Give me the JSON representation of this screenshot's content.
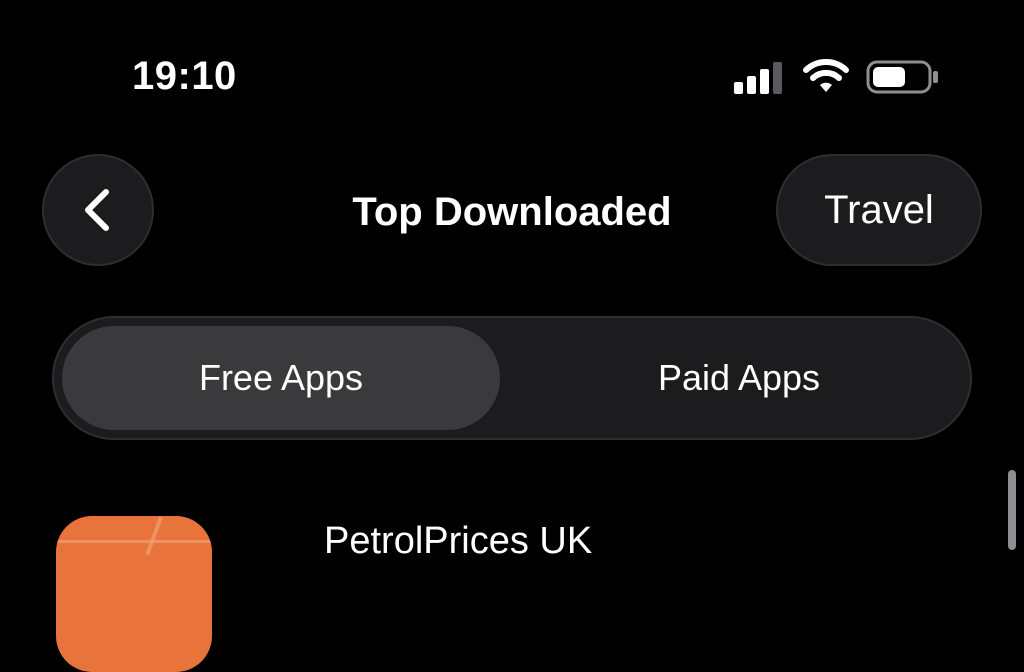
{
  "status_bar": {
    "time": "19:10",
    "signal_icon": "cellular-signal-icon",
    "wifi_icon": "wifi-icon",
    "battery_icon": "battery-icon"
  },
  "header": {
    "back_icon": "chevron-left-icon",
    "title": "Top Downloaded",
    "category_label": "Travel"
  },
  "segments": {
    "items": [
      {
        "label": "Free Apps",
        "selected": true
      },
      {
        "label": "Paid Apps",
        "selected": false
      }
    ]
  },
  "app_list": {
    "items": [
      {
        "name": "PetrolPrices UK",
        "icon_color": "#e8743b"
      }
    ]
  },
  "colors": {
    "background": "#000000",
    "control_background": "#1c1c1e",
    "selected_segment": "#3a3a3c",
    "text": "#ffffff"
  }
}
